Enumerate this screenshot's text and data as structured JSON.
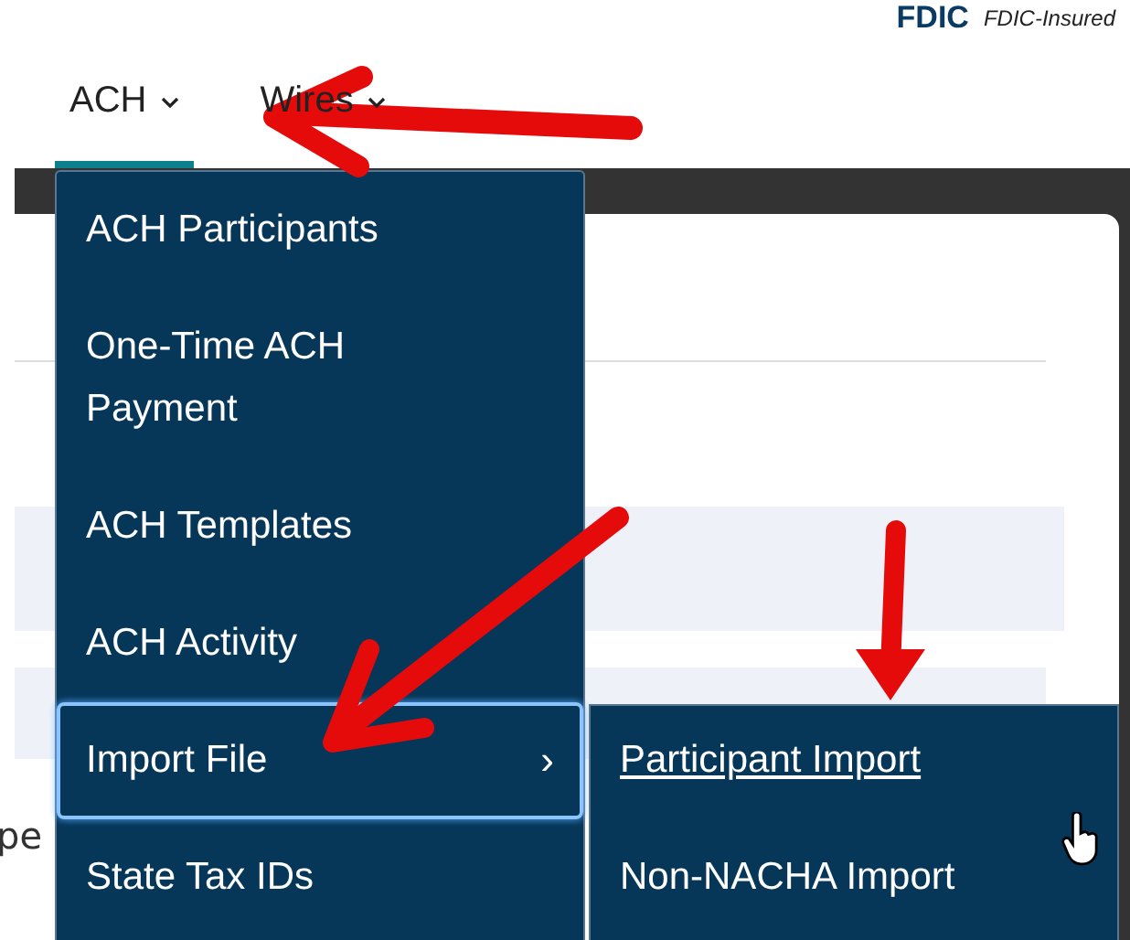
{
  "header": {
    "logo": "FDIC",
    "tagline": "FDIC-Insured"
  },
  "nav": [
    {
      "label": "ACH",
      "selected": true
    },
    {
      "label": "Wires",
      "selected": false
    }
  ],
  "background_text": "pe",
  "menu": [
    {
      "label": "ACH Participants",
      "highlighted": false
    },
    {
      "label": "One-Time ACH Payment",
      "highlighted": false
    },
    {
      "label": "ACH Templates",
      "highlighted": false
    },
    {
      "label": "ACH Activity",
      "highlighted": false
    },
    {
      "label": "Import File",
      "highlighted": true,
      "submenu_caret": "›"
    },
    {
      "label": "State Tax IDs",
      "highlighted": false
    }
  ],
  "submenu": [
    {
      "label": "Participant Import",
      "hovered": true
    },
    {
      "label": "Non-NACHA Import",
      "hovered": false
    }
  ]
}
